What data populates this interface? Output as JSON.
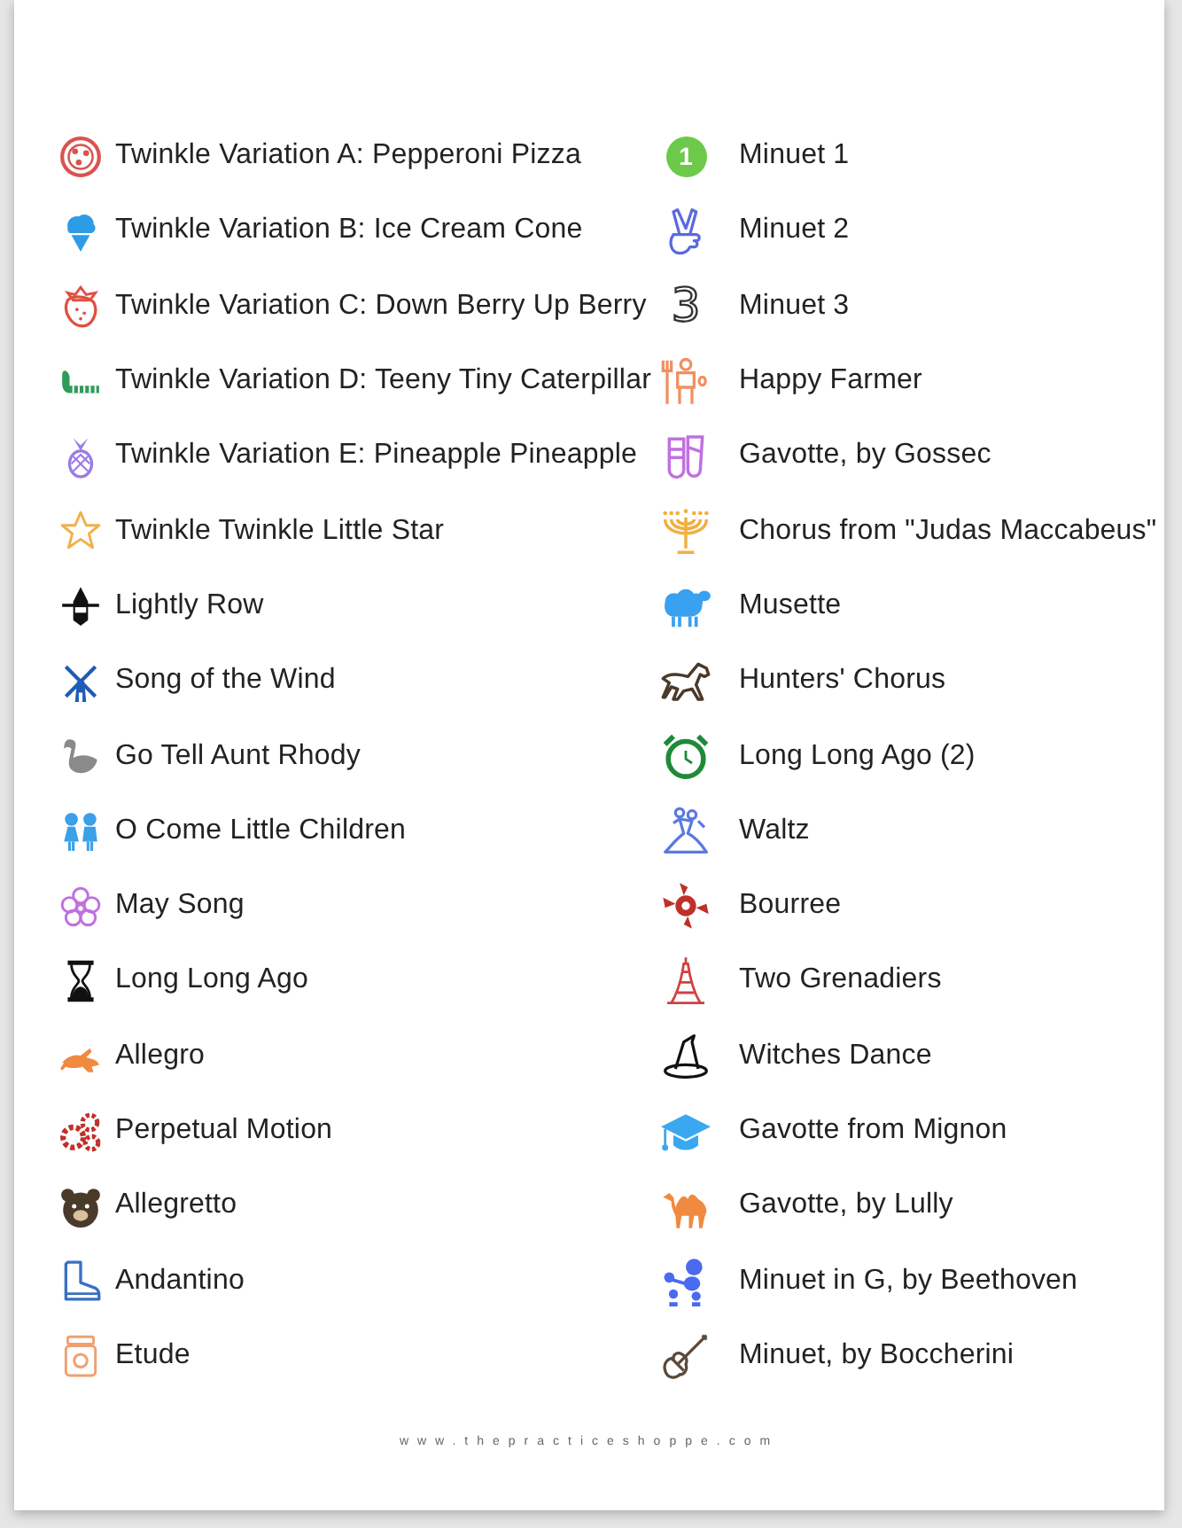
{
  "columns": [
    {
      "items": [
        {
          "kind": "icon",
          "title": "Twinkle Variation A: Pepperoni Pizza"
        },
        {
          "kind": "icon",
          "title": "Twinkle Variation B: Ice Cream Cone"
        },
        {
          "kind": "icon",
          "title": "Twinkle Variation C: Down Berry Up Berry"
        },
        {
          "kind": "icon",
          "title": "Twinkle Variation D: Teeny Tiny Caterpillar"
        },
        {
          "kind": "icon",
          "title": "Twinkle Variation E: Pineapple Pineapple"
        },
        {
          "kind": "icon",
          "title": "Twinkle Twinkle Little Star"
        },
        {
          "kind": "icon",
          "title": "Lightly Row"
        },
        {
          "kind": "icon",
          "title": "Song of the Wind"
        },
        {
          "kind": "icon",
          "title": "Go Tell Aunt Rhody"
        },
        {
          "kind": "icon",
          "title": "O Come Little Children"
        },
        {
          "kind": "icon",
          "title": "May Song"
        },
        {
          "kind": "icon",
          "title": "Long Long Ago"
        },
        {
          "kind": "icon",
          "title": "Allegro"
        },
        {
          "kind": "icon",
          "title": "Perpetual Motion"
        },
        {
          "kind": "icon",
          "title": "Allegretto"
        },
        {
          "kind": "icon",
          "title": "Andantino"
        },
        {
          "kind": "icon",
          "title": "Etude"
        }
      ]
    },
    {
      "items": [
        {
          "kind": "badge",
          "badge": "1",
          "title": "Minuet 1"
        },
        {
          "kind": "icon",
          "title": "Minuet 2"
        },
        {
          "kind": "numeral",
          "badge": "3",
          "title": "Minuet 3"
        },
        {
          "kind": "icon",
          "title": "Happy Farmer"
        },
        {
          "kind": "icon",
          "title": "Gavotte, by Gossec"
        },
        {
          "kind": "icon",
          "title": "Chorus from \"Judas Maccabeus\""
        },
        {
          "kind": "icon",
          "title": "Musette"
        },
        {
          "kind": "icon",
          "title": "Hunters' Chorus"
        },
        {
          "kind": "icon",
          "title": "Long Long Ago (2)"
        },
        {
          "kind": "icon",
          "title": "Waltz"
        },
        {
          "kind": "icon",
          "title": "Bourree"
        },
        {
          "kind": "icon",
          "title": "Two Grenadiers"
        },
        {
          "kind": "icon",
          "title": "Witches Dance"
        },
        {
          "kind": "icon",
          "title": "Gavotte from Mignon"
        },
        {
          "kind": "icon",
          "title": "Gavotte, by Lully"
        },
        {
          "kind": "icon",
          "title": "Minuet in G, by Beethoven"
        },
        {
          "kind": "icon",
          "title": "Minuet, by Boccherini"
        }
      ]
    }
  ],
  "footer": "www.thepracticeshoppe.com"
}
